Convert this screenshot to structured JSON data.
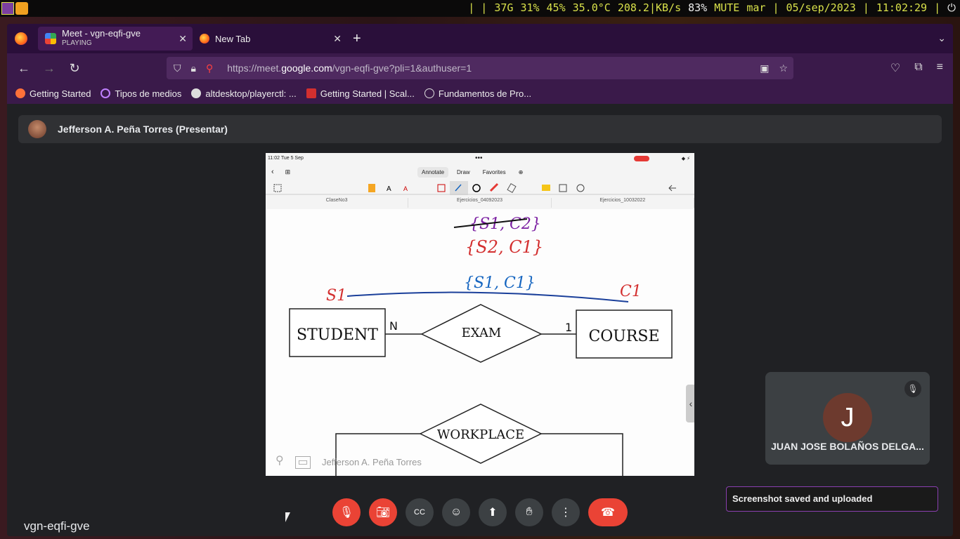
{
  "sysbar": {
    "stats": [
      "| |",
      "37G",
      "31%",
      "45%",
      "35.0°C",
      "208.2|KB/s",
      "83%",
      "MUTE",
      "mar",
      "|",
      "05/sep/2023",
      "|",
      "11:02:29",
      "|"
    ]
  },
  "tabs": [
    {
      "title": "Meet - vgn-eqfi-gve",
      "subtitle": "PLAYING"
    },
    {
      "title": "New Tab"
    }
  ],
  "url": {
    "prefix": "https://meet.",
    "domain": "google.com",
    "path": "/vgn-eqfi-gve?pli=1&authuser=1"
  },
  "bookmarks": [
    "Getting Started",
    "Tipos de medios",
    "altdesktop/playerctl: ...",
    "Getting Started | Scal...",
    "Fundamentos de Pro..."
  ],
  "presenter": {
    "label": "Jefferson A. Peña Torres (Presentar)"
  },
  "ipad": {
    "status_time": "11:02  Tue 5 Sep",
    "tabs": [
      "Annotate",
      "Draw",
      "Favorites"
    ],
    "doc_tabs": [
      "ClaseNo3",
      "Ejercicios_04092023",
      "Ejercicios_10032022"
    ],
    "overlay_name": "Jefferson A. Peña Torres"
  },
  "diagram": {
    "note1": "{S1, C2}",
    "note2": "{S2, C1}",
    "note3": "{S1, C1}",
    "s1": "S1",
    "c1": "C1",
    "student": "STUDENT",
    "exam": "EXAM",
    "course": "COURSE",
    "card_n": "N",
    "card_1": "1",
    "workplace": "WORKPLACE"
  },
  "meet_code": "vgn-eqfi-gve",
  "participant": {
    "initial": "J",
    "name": "JUAN JOSE BOLAÑOS DELGA..."
  },
  "toast": "Screenshot saved and uploaded"
}
